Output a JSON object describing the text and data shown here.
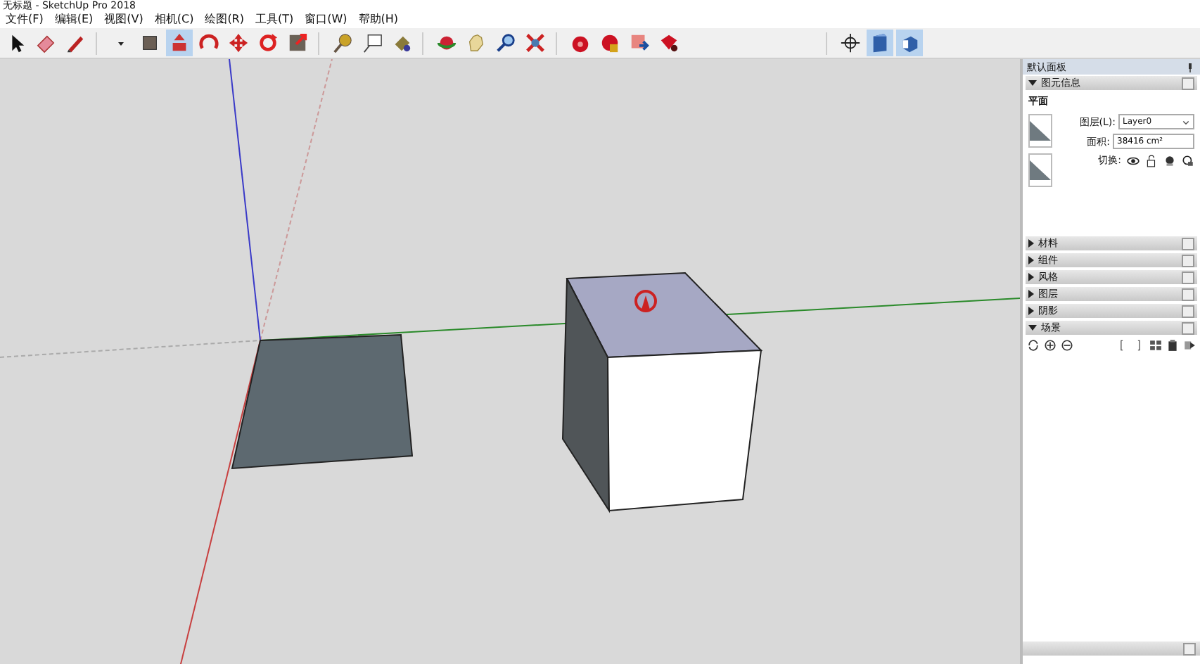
{
  "window": {
    "title": "无标题 - SketchUp Pro 2018"
  },
  "menu": [
    "文件(F)",
    "编辑(E)",
    "视图(V)",
    "相机(C)",
    "绘图(R)",
    "工具(T)",
    "窗口(W)",
    "帮助(H)"
  ],
  "toolbar_buttons": [
    {
      "selected": false
    },
    {
      "selected": false
    },
    {
      "selected": false
    },
    {
      "selected": false
    },
    {
      "selected": false
    },
    {
      "selected": true
    },
    {
      "selected": false
    },
    {
      "selected": false
    },
    {
      "selected": false
    },
    {
      "selected": false
    },
    {
      "selected": false
    },
    {
      "selected": false
    },
    {
      "selected": false
    },
    {
      "selected": false
    },
    {
      "selected": false
    },
    {
      "selected": false
    },
    {
      "selected": false
    },
    {
      "selected": false
    },
    {
      "selected": false
    },
    {
      "selected": false
    },
    {
      "selected": false
    },
    {
      "selected": false
    },
    {
      "selected": true
    },
    {
      "selected": true
    }
  ],
  "panel": {
    "title": "默认面板",
    "entity_info": {
      "title": "图元信息",
      "expanded": true,
      "entity_type": "平面",
      "layer_label": "图层(L):",
      "layer_value": "Layer0",
      "area_label": "面积:",
      "area_value": "38416 cm²",
      "toggles_label": "切换:"
    },
    "sections": [
      {
        "title": "材料",
        "expanded": false
      },
      {
        "title": "组件",
        "expanded": false
      },
      {
        "title": "风格",
        "expanded": false
      },
      {
        "title": "图层",
        "expanded": false
      },
      {
        "title": "阴影",
        "expanded": false
      },
      {
        "title": "场景",
        "expanded": true
      }
    ]
  }
}
